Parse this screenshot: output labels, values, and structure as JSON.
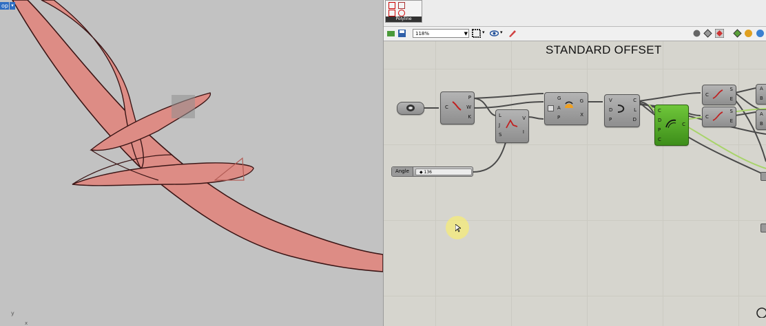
{
  "viewport": {
    "label": "op",
    "axis_y": "y",
    "axis_x": "x"
  },
  "gh": {
    "palette_label": "Polyline",
    "zoom": "118%",
    "canvas_title": "STANDARD OFFSET",
    "components": {
      "c1": {
        "in": [
          "C"
        ],
        "out": [
          "P",
          "W",
          "K"
        ]
      },
      "c2": {
        "in": [
          "L",
          "J",
          "S"
        ],
        "out": [
          "V",
          "I"
        ]
      },
      "c3": {
        "in": [
          "G",
          "A",
          "P"
        ],
        "out": [
          "G",
          "X"
        ]
      },
      "c4": {
        "in": [
          "V",
          "D",
          "P"
        ],
        "out": [
          "C",
          "L",
          "D"
        ]
      },
      "c5": {
        "in": [
          "C",
          "D",
          "P",
          "C"
        ],
        "out": [
          "C"
        ]
      },
      "c6": {
        "in": [
          "C"
        ],
        "out": [
          "S",
          "E"
        ]
      },
      "c7": {
        "in": [
          "C"
        ],
        "out": [
          "S",
          "E"
        ]
      },
      "c8": {
        "in": [
          "A",
          "B"
        ]
      },
      "c9": {
        "in": [
          "A",
          "B"
        ]
      }
    },
    "slider": {
      "name": "Angle",
      "value": "◆ 136"
    }
  }
}
